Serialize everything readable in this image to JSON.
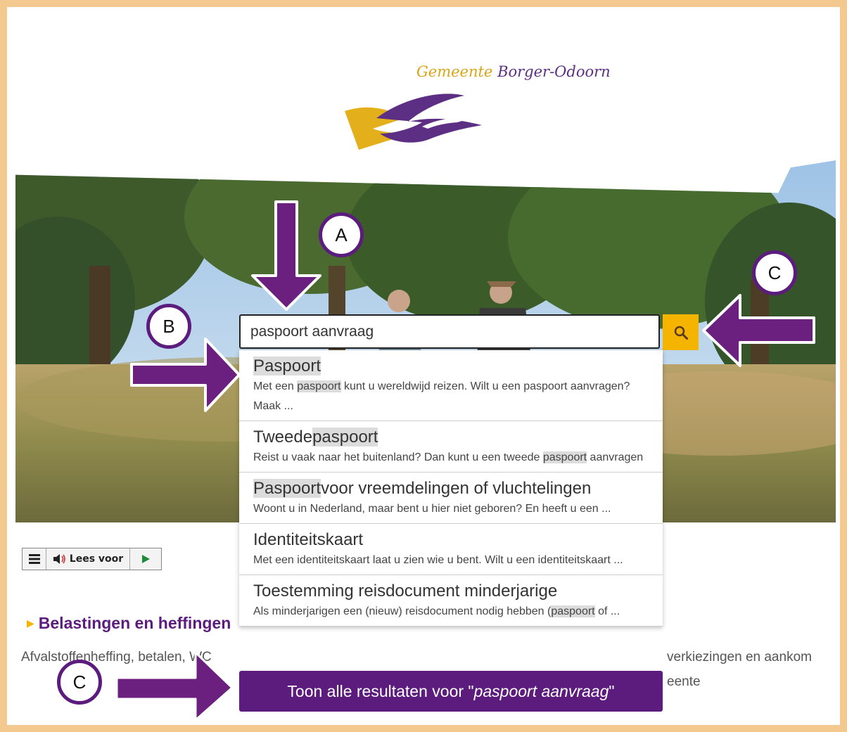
{
  "header": {
    "logo_word1": "Gemeente",
    "logo_word2": "Borger-Odoorn"
  },
  "search": {
    "value": "paspoort aanvraag",
    "button_icon": "search-icon"
  },
  "suggestions": [
    {
      "title_parts": [
        {
          "text": "Paspoort",
          "hl": true
        }
      ],
      "desc_parts": [
        {
          "text": "Met een ",
          "hl": false
        },
        {
          "text": "paspoort",
          "hl": true
        },
        {
          "text": " kunt u wereldwijd reizen. Wilt u een paspoort aanvragen? Maak ...",
          "hl": false
        }
      ]
    },
    {
      "title_parts": [
        {
          "text": "Tweede",
          "hl": false
        },
        {
          "text": "paspoort",
          "hl": true
        }
      ],
      "desc_parts": [
        {
          "text": "Reist u vaak naar het buitenland? Dan kunt u een tweede ",
          "hl": false
        },
        {
          "text": "paspoort",
          "hl": true
        },
        {
          "text": " aanvragen",
          "hl": false
        }
      ]
    },
    {
      "title_parts": [
        {
          "text": "Paspoort",
          "hl": true
        },
        {
          "text": "voor vreemdelingen of vluchtelingen",
          "hl": false
        }
      ],
      "desc_parts": [
        {
          "text": "Woont u in Nederland, maar bent u hier niet geboren? En heeft u een ...",
          "hl": false
        }
      ]
    },
    {
      "title_parts": [
        {
          "text": "Identiteitskaart",
          "hl": false
        }
      ],
      "desc_parts": [
        {
          "text": "Met een identiteitskaart laat u zien wie u bent. Wilt u een identiteitskaart ...",
          "hl": false
        }
      ]
    },
    {
      "title_parts": [
        {
          "text": "Toestemming reisdocument minderjarige",
          "hl": false
        }
      ],
      "desc_parts": [
        {
          "text": "Als minderjarigen een (nieuw) reisdocument nodig hebben (",
          "hl": false
        },
        {
          "text": "paspoort",
          "hl": true
        },
        {
          "text": " of ...",
          "hl": false
        }
      ]
    }
  ],
  "show_all": {
    "prefix": "Toon alle resultaten voor \"",
    "query": "paspoort aanvraag",
    "suffix": "\""
  },
  "readbar": {
    "menu_icon": "menu-icon",
    "speaker_icon": "speaker-icon",
    "label": "Lees voor",
    "play_icon": "play-icon"
  },
  "content": {
    "heading": "Belastingen en heffingen",
    "text_left": "Afvalstoffenheffing, betalen, WC",
    "text_right1": "verkiezingen en aankom",
    "text_right2": "eente"
  },
  "annotations": {
    "a": "A",
    "b": "B",
    "c_top": "C",
    "c_bottom": "C"
  },
  "colors": {
    "frame": "#f4c98f",
    "brand_purple": "#5c1c7e",
    "brand_yellow": "#f5b400",
    "arrow_purple": "#6b1f7e"
  }
}
